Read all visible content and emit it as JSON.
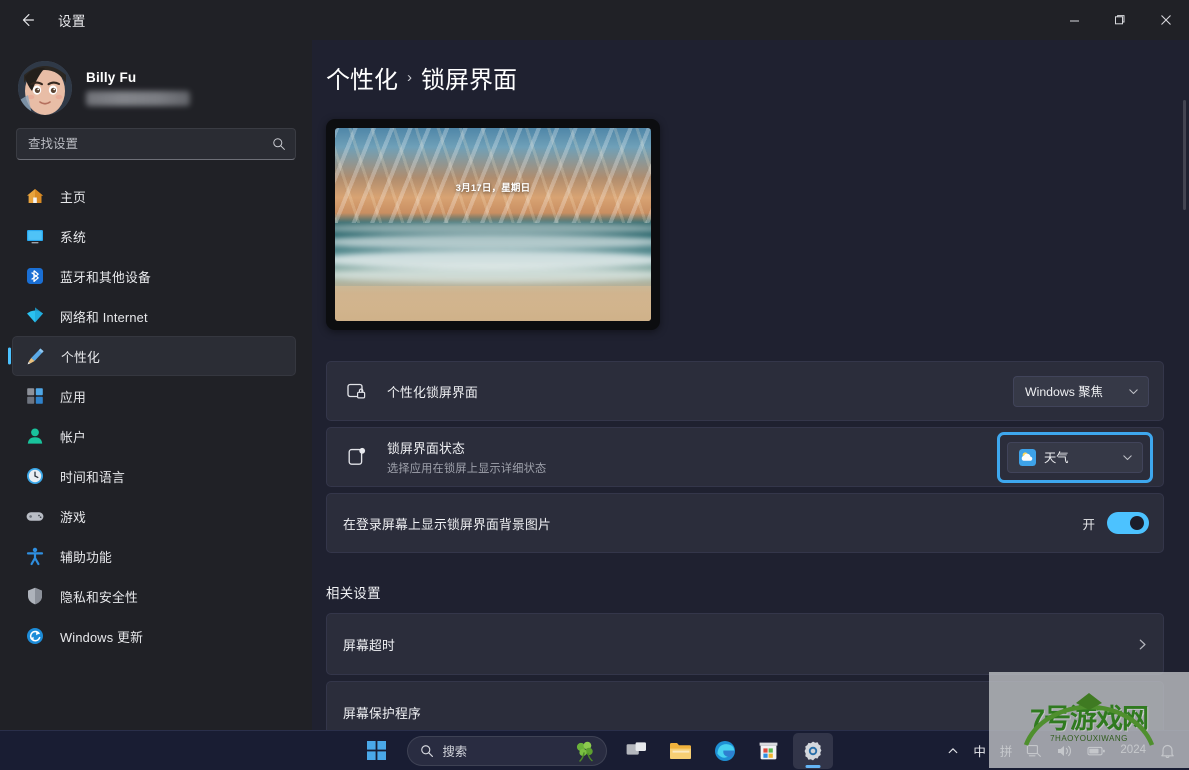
{
  "window": {
    "title": "设置",
    "back_icon": "back-arrow-icon",
    "minimize_label": "最小化",
    "maximize_label": "还原",
    "close_label": "关闭"
  },
  "sidebar": {
    "profile": {
      "name": "Billy Fu",
      "email_masked": ""
    },
    "search": {
      "placeholder": "查找设置",
      "value": "",
      "icon": "search-icon"
    },
    "items": [
      {
        "label": "主页",
        "icon": "home-icon",
        "active": false
      },
      {
        "label": "系统",
        "icon": "system-icon",
        "active": false
      },
      {
        "label": "蓝牙和其他设备",
        "icon": "bluetooth-icon",
        "active": false
      },
      {
        "label": "网络和 Internet",
        "icon": "network-icon",
        "active": false
      },
      {
        "label": "个性化",
        "icon": "personalization-icon",
        "active": true
      },
      {
        "label": "应用",
        "icon": "apps-icon",
        "active": false
      },
      {
        "label": "帐户",
        "icon": "accounts-icon",
        "active": false
      },
      {
        "label": "时间和语言",
        "icon": "time-language-icon",
        "active": false
      },
      {
        "label": "游戏",
        "icon": "gaming-icon",
        "active": false
      },
      {
        "label": "辅助功能",
        "icon": "accessibility-icon",
        "active": false
      },
      {
        "label": "隐私和安全性",
        "icon": "privacy-security-icon",
        "active": false
      },
      {
        "label": "Windows 更新",
        "icon": "windows-update-icon",
        "active": false
      }
    ]
  },
  "main": {
    "breadcrumb": {
      "parent": "个性化",
      "separator": "›",
      "current": "锁屏界面"
    },
    "preview": {
      "date_text": "3月17日，星期日",
      "description": "海滩日落海浪壁纸预览"
    },
    "settings": [
      {
        "title": "个性化锁屏界面",
        "subtitle": "",
        "icon": "lock-screen-icon",
        "control": "dropdown",
        "value": "Windows 聚焦",
        "focused": false
      },
      {
        "title": "锁屏界面状态",
        "subtitle": "选择应用在锁屏上显示详细状态",
        "icon": "lock-status-icon",
        "control": "dropdown",
        "value": "天气",
        "value_icon": "weather-icon",
        "focused": true
      },
      {
        "title": "在登录屏幕上显示锁屏界面背景图片",
        "subtitle": "",
        "icon": "",
        "control": "toggle",
        "toggle_state_label": "开",
        "toggle_on": true
      }
    ],
    "related": {
      "heading": "相关设置",
      "items": [
        {
          "title": "屏幕超时",
          "icon": "chevron-right-icon"
        },
        {
          "title": "屏幕保护程序",
          "icon": "chevron-right-icon"
        }
      ]
    }
  },
  "taskbar": {
    "start_label": "开始",
    "search": {
      "placeholder": "搜索",
      "icon": "search-icon",
      "widget_icon": "clover-icon"
    },
    "buttons": [
      {
        "name": "task-view",
        "label": "任务视图"
      },
      {
        "name": "file-explorer",
        "label": "文件资源管理器"
      },
      {
        "name": "edge",
        "label": "Microsoft Edge"
      },
      {
        "name": "store",
        "label": "Microsoft Store"
      },
      {
        "name": "settings",
        "label": "设置",
        "active": true
      }
    ],
    "tray": {
      "overflow": "︿",
      "ime_mode": "中",
      "ime_pinyin": "拼",
      "items": [
        "ime-tool-icon",
        "volume-icon",
        "battery-icon"
      ],
      "clock": "2024",
      "notifications_icon": "bell-icon"
    }
  },
  "watermark": {
    "main": "7号游戏网",
    "sub": "7HAOYOUXIWANG",
    "color": "#2f7a1f"
  },
  "theme": {
    "accent": "#4cc2ff",
    "focus_ring": "#3ea7ee",
    "sidebar_bg": "#202126",
    "content_bg": "#1f2130",
    "card_bg": "#2b2d3b",
    "taskbar_bg": "#191d33"
  }
}
